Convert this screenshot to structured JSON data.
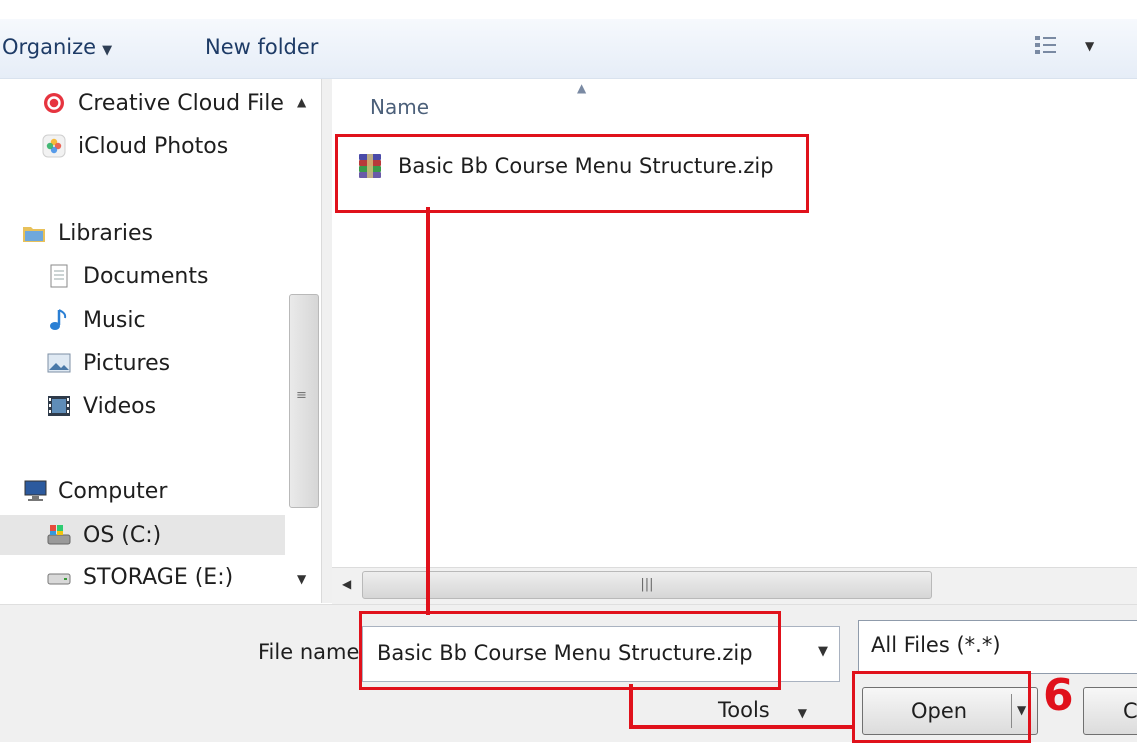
{
  "toolbar": {
    "organize_label": "Organize",
    "new_folder_label": "New folder"
  },
  "nav": {
    "items": [
      {
        "label": "Creative Cloud File",
        "icon": "creative-cloud-icon"
      },
      {
        "label": "iCloud Photos",
        "icon": "icloud-photos-icon"
      },
      {
        "label": "Libraries",
        "icon": "libraries-icon"
      },
      {
        "label": "Documents",
        "icon": "documents-icon"
      },
      {
        "label": "Music",
        "icon": "music-icon"
      },
      {
        "label": "Pictures",
        "icon": "pictures-icon"
      },
      {
        "label": "Videos",
        "icon": "videos-icon"
      },
      {
        "label": "Computer",
        "icon": "computer-icon"
      },
      {
        "label": "OS (C:)",
        "icon": "os-drive-icon",
        "selected": true
      },
      {
        "label": "STORAGE (E:)",
        "icon": "storage-drive-icon"
      }
    ]
  },
  "content": {
    "column_header": "Name",
    "files": [
      {
        "name": "Basic Bb Course Menu Structure.zip",
        "icon": "winrar-archive-icon"
      }
    ]
  },
  "bottom": {
    "file_name_label": "File name",
    "file_name_value": "Basic Bb Course Menu Structure.zip",
    "file_type_value": "All Files (*.*)",
    "tools_label": "Tools",
    "open_label": "Open",
    "cancel_partial": "C"
  },
  "annotation": {
    "step_number": "6",
    "color": "#e0111b"
  }
}
